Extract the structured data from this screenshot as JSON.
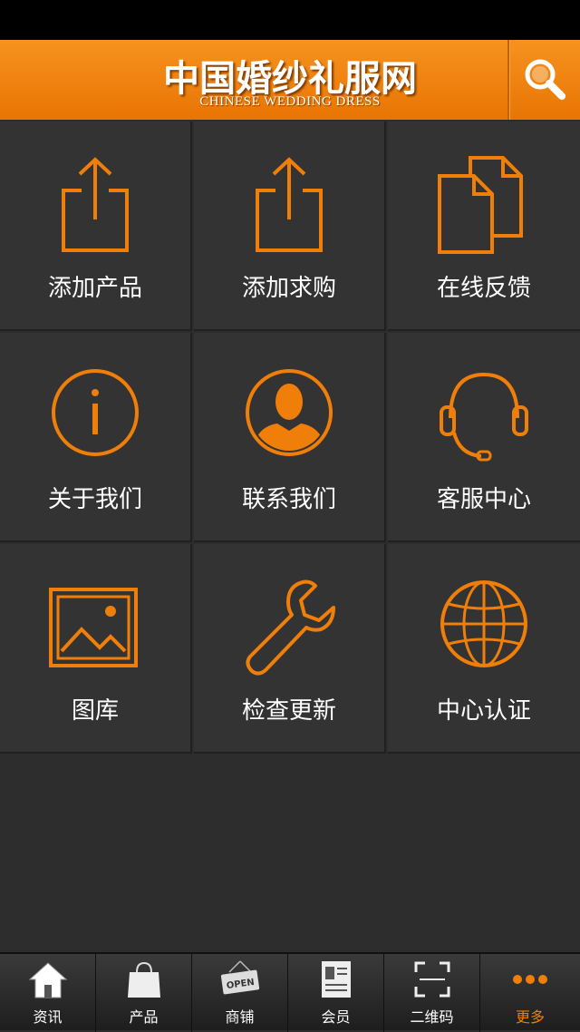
{
  "header": {
    "title": "中国婚纱礼服网",
    "subtitle": "CHINESE WEDDING DRESS",
    "search_icon": "search-icon"
  },
  "colors": {
    "accent": "#f07f0a",
    "background": "#2d2d2d",
    "tile": "#333333"
  },
  "grid": [
    {
      "label": "添加产品",
      "icon": "share-upload-icon"
    },
    {
      "label": "添加求购",
      "icon": "share-upload-icon"
    },
    {
      "label": "在线反馈",
      "icon": "documents-icon"
    },
    {
      "label": "关于我们",
      "icon": "info-icon"
    },
    {
      "label": "联系我们",
      "icon": "user-icon"
    },
    {
      "label": "客服中心",
      "icon": "headset-icon"
    },
    {
      "label": "图库",
      "icon": "image-icon"
    },
    {
      "label": "检查更新",
      "icon": "wrench-icon"
    },
    {
      "label": "中心认证",
      "icon": "globe-icon"
    }
  ],
  "tabs": [
    {
      "label": "资讯",
      "icon": "home-icon"
    },
    {
      "label": "产品",
      "icon": "shopping-bag-icon"
    },
    {
      "label": "商铺",
      "icon": "open-sign-icon",
      "sign_text": "OPEN"
    },
    {
      "label": "会员",
      "icon": "id-card-icon"
    },
    {
      "label": "二维码",
      "icon": "qr-scan-icon"
    },
    {
      "label": "更多",
      "icon": "more-icon",
      "active": true
    }
  ]
}
